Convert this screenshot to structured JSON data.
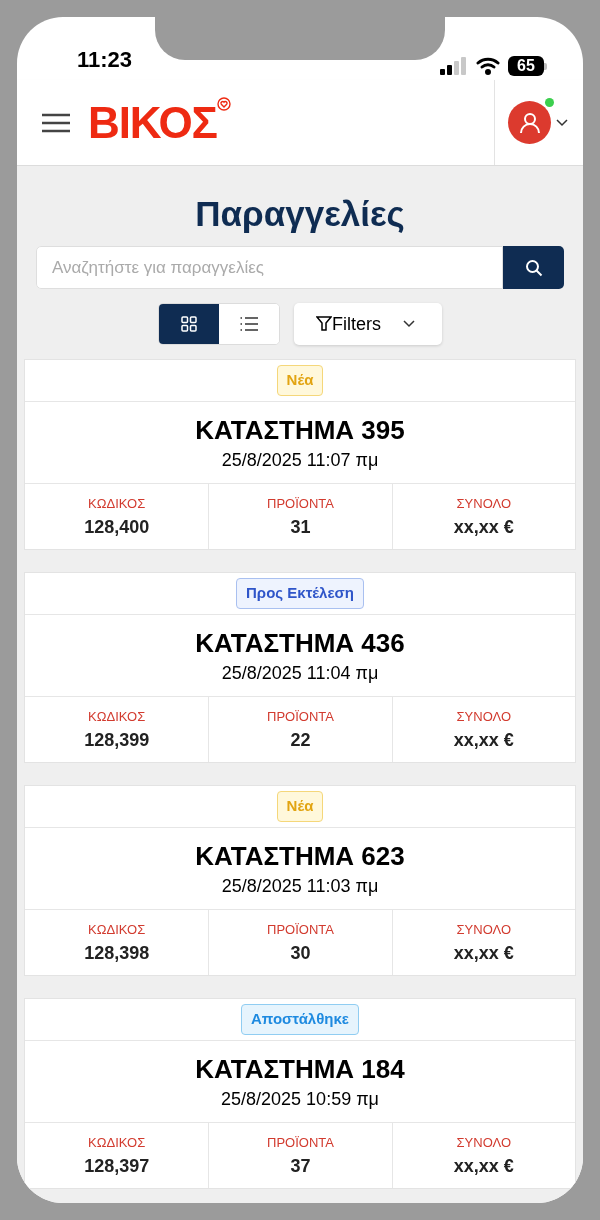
{
  "status_bar": {
    "time": "11:23",
    "battery": "65"
  },
  "header": {
    "logo": "ΒΙΚΟΣ",
    "user_online": true
  },
  "page_title": "Παραγγελίες",
  "search": {
    "placeholder": "Αναζητήστε για παραγγελίες"
  },
  "view_toggle": [
    {
      "kind": "grid",
      "selected": true
    },
    {
      "kind": "list",
      "selected": false
    }
  ],
  "filters_button": "Filters",
  "orders": [
    {
      "status": {
        "label": "Νέα",
        "kind": "new"
      },
      "store": "ΚΑΤΑΣΤΗΜΑ 395",
      "date": "25/8/2025 11:07 πμ",
      "stats": [
        {
          "label": "ΚΩΔΙΚΟΣ",
          "value": "128,400"
        },
        {
          "label": "ΠΡΟΪΟΝΤΑ",
          "value": "31"
        },
        {
          "label": "ΣΥΝΟΛΟ",
          "value": "xx,xx €"
        }
      ]
    },
    {
      "status": {
        "label": "Προς Εκτέλεση",
        "kind": "pending"
      },
      "store": "ΚΑΤΑΣΤΗΜΑ 436",
      "date": "25/8/2025 11:04 πμ",
      "stats": [
        {
          "label": "ΚΩΔΙΚΟΣ",
          "value": "128,399"
        },
        {
          "label": "ΠΡΟΪΟΝΤΑ",
          "value": "22"
        },
        {
          "label": "ΣΥΝΟΛΟ",
          "value": "xx,xx €"
        }
      ]
    },
    {
      "status": {
        "label": "Νέα",
        "kind": "new"
      },
      "store": "ΚΑΤΑΣΤΗΜΑ 623",
      "date": "25/8/2025 11:03 πμ",
      "stats": [
        {
          "label": "ΚΩΔΙΚΟΣ",
          "value": "128,398"
        },
        {
          "label": "ΠΡΟΪΟΝΤΑ",
          "value": "30"
        },
        {
          "label": "ΣΥΝΟΛΟ",
          "value": "xx,xx €"
        }
      ]
    },
    {
      "status": {
        "label": "Αποστάλθηκε",
        "kind": "shipped"
      },
      "store": "ΚΑΤΑΣΤΗΜΑ 184",
      "date": "25/8/2025 10:59 πμ",
      "stats": [
        {
          "label": "ΚΩΔΙΚΟΣ",
          "value": "128,397"
        },
        {
          "label": "ΠΡΟΪΟΝΤΑ",
          "value": "37"
        },
        {
          "label": "ΣΥΝΟΛΟ",
          "value": "xx,xx €"
        }
      ]
    }
  ]
}
